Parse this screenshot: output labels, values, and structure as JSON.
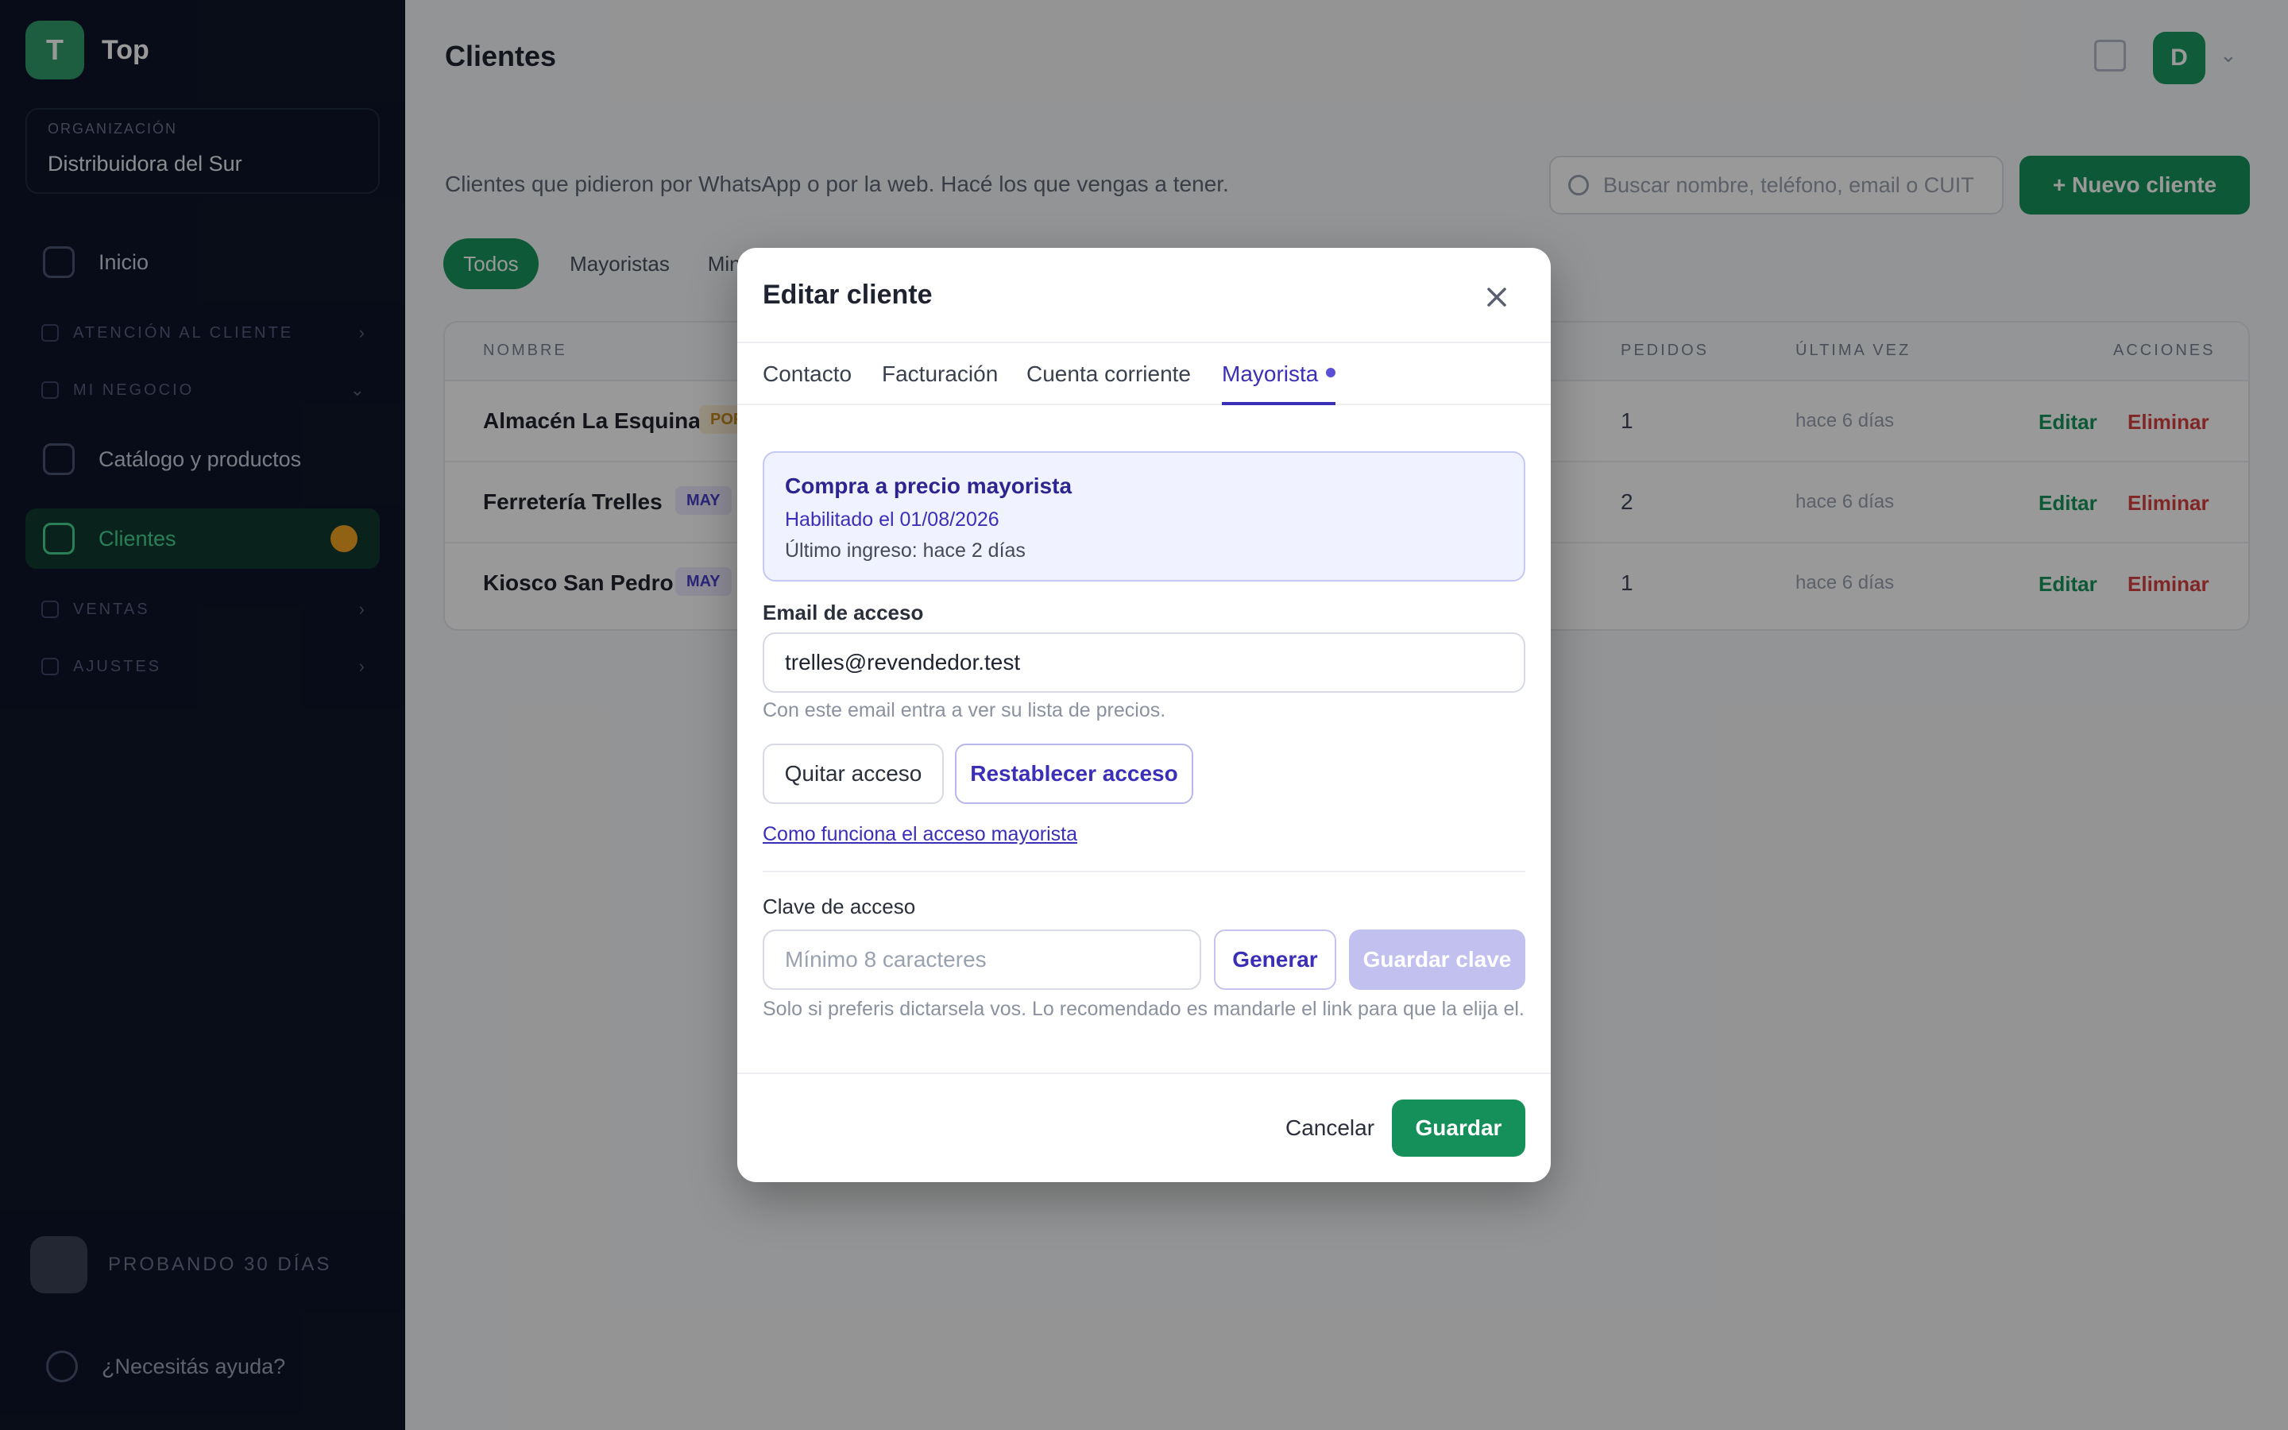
{
  "app": {
    "brand_short": "Top",
    "brand_accent": "#29c17b",
    "logo_glyph": "T"
  },
  "sidebar": {
    "org_label": "ORGANIZACIÓN",
    "org_name": "Distribuidora del Sur",
    "items": [
      {
        "label": "Inicio",
        "icon": "home-icon"
      },
      {
        "label": "Catálogo y productos",
        "icon": "catalog-icon"
      },
      {
        "label": "Clientes",
        "icon": "users-icon",
        "active": true
      }
    ],
    "sections": [
      {
        "label": "ATENCIÓN AL CLIENTE"
      },
      {
        "label": "MI NEGOCIO"
      },
      {
        "label": "VENTAS"
      },
      {
        "label": "AJUSTES"
      }
    ],
    "footer_text": "PROBANDO 30 DÍAS",
    "help_label": "¿Necesitás ayuda?"
  },
  "main": {
    "title": "Clientes",
    "avatar_initial": "D",
    "subtitle": "Clientes que pidieron por WhatsApp o por la web. Hacé los que vengas a tener.",
    "search_placeholder": "Buscar nombre, teléfono, email o CUIT",
    "new_button": "+ Nuevo cliente",
    "chips": [
      "Todos",
      "Mayoristas",
      "Minoristas"
    ],
    "table": {
      "headers": [
        "NOMBRE",
        "PEDIDOS",
        "ÚLTIMA VEZ",
        "ACCIONES"
      ],
      "rows": [
        {
          "name": "Almacén La Esquina",
          "tag": "POR",
          "orders": "1",
          "last": "hace 6 días",
          "edit": "Editar",
          "delete": "Eliminar"
        },
        {
          "name": "Ferretería Trelles",
          "tag": "MAY",
          "orders": "2",
          "last": "hace 6 días",
          "edit": "Editar",
          "delete": "Eliminar"
        },
        {
          "name": "Kiosco San Pedro",
          "tag": "MAY",
          "orders": "1",
          "last": "hace 6 días",
          "edit": "Editar",
          "delete": "Eliminar"
        }
      ]
    }
  },
  "modal": {
    "title": "Editar cliente",
    "tabs": [
      "Contacto",
      "Facturación",
      "Cuenta corriente",
      "Mayorista"
    ],
    "active_tab": "Mayorista",
    "info": {
      "title": "Compra a precio mayorista",
      "enabled": "Habilitado el 01/08/2026",
      "last_login": "Último ingreso: hace 2 días"
    },
    "email": {
      "label": "Email de acceso",
      "value": "trelles@revendedor.test",
      "help": "Con este email entra a ver su lista de precios."
    },
    "buttons": {
      "remove_access": "Quitar acceso",
      "reset_access": "Restablecer acceso"
    },
    "help_link": "Como funciona el acceso mayorista",
    "password": {
      "label": "Clave de acceso",
      "placeholder": "Mínimo 8 caracteres",
      "generate": "Generar",
      "save": "Guardar clave",
      "help": "Solo si preferis dictarsela vos. Lo recomendado es mandarle el link para que la elija el."
    },
    "footer": {
      "cancel": "Cancelar",
      "save": "Guardar"
    }
  },
  "colors": {
    "primary_green": "#16905a",
    "accent_purple": "#3b2fb8",
    "sidebar_bg": "#0d1528"
  }
}
